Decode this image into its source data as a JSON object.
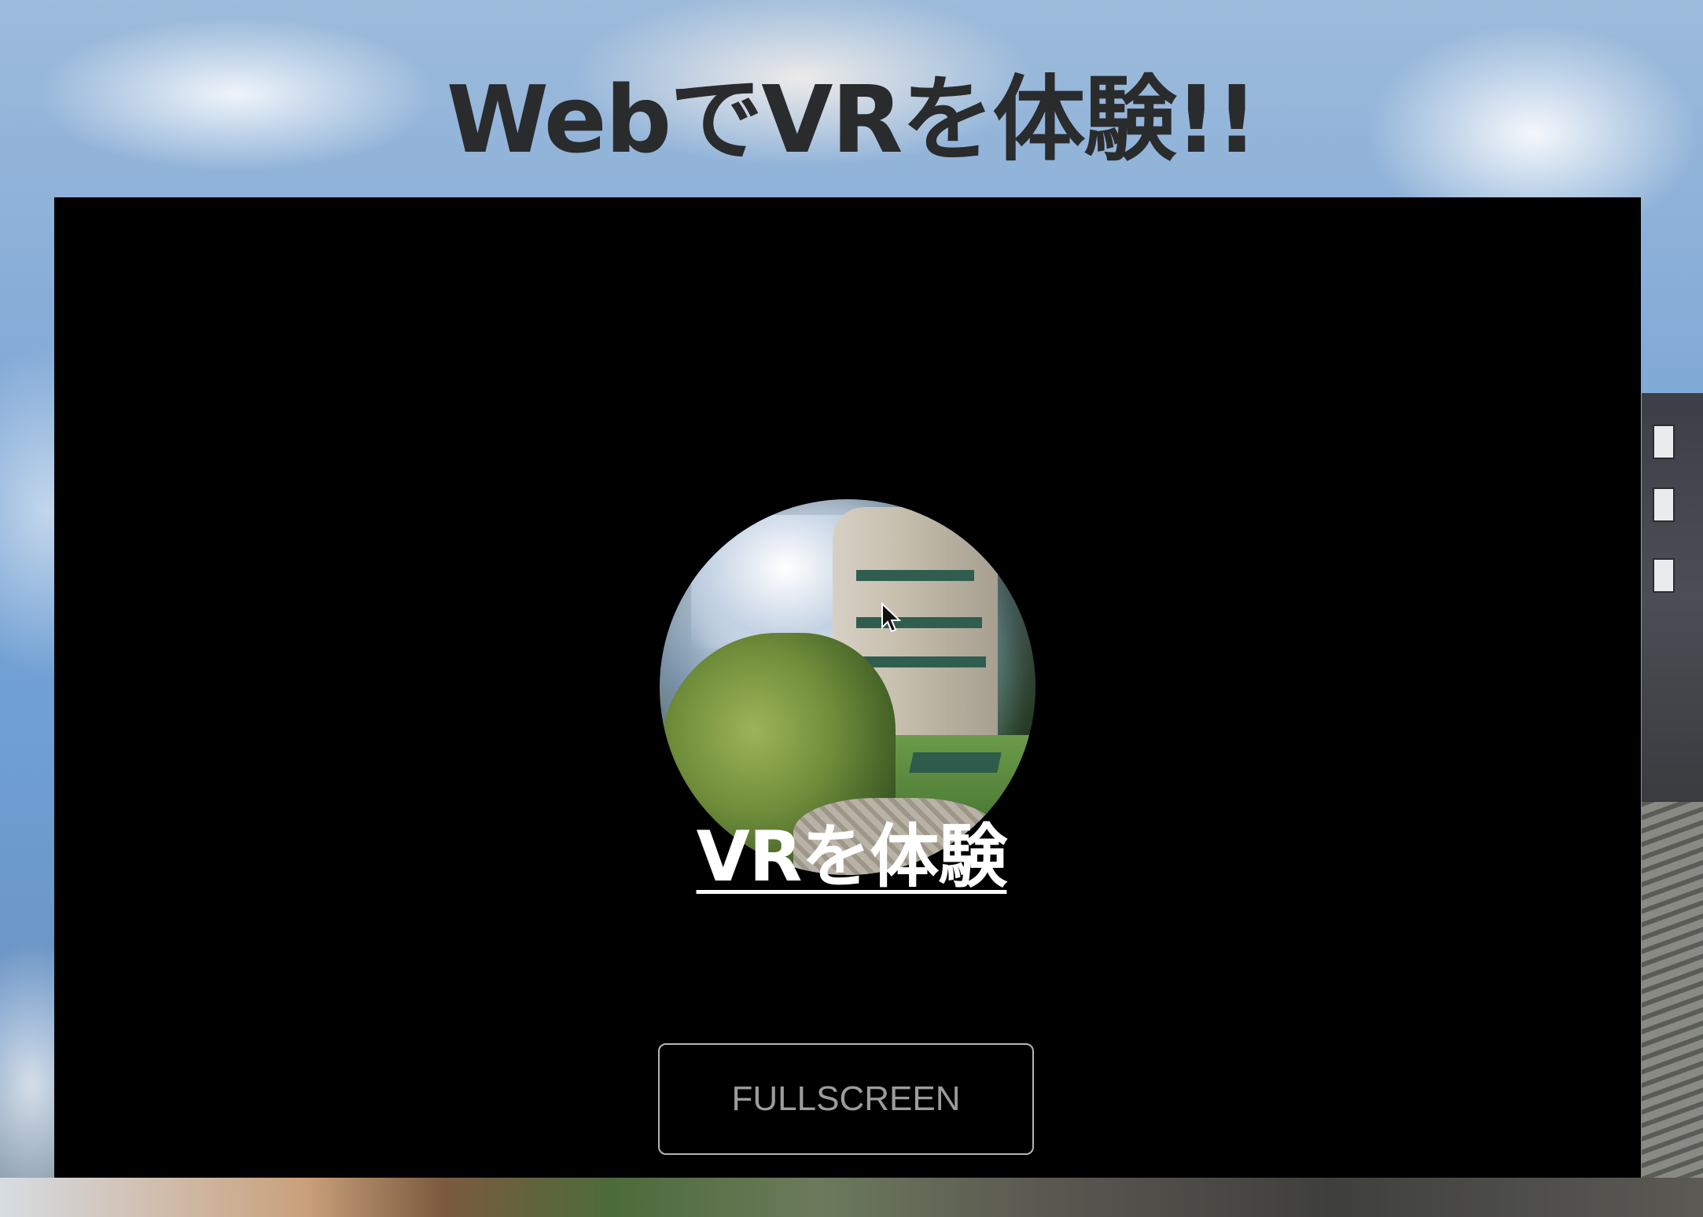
{
  "page": {
    "title": "WebでVRを体験!!"
  },
  "vr_scene": {
    "enter_vr_link": "VRを体験",
    "fullscreen_label": "FULLSCREEN",
    "preview_icon": "panorama-sphere",
    "cursor_icon": "arrow-cursor-icon"
  },
  "colors": {
    "stage_background": "#000000",
    "title_text": "#2a2b2d",
    "link_text": "#ffffff",
    "button_border": "#b5b5b5",
    "button_text": "#9c9c9c"
  }
}
